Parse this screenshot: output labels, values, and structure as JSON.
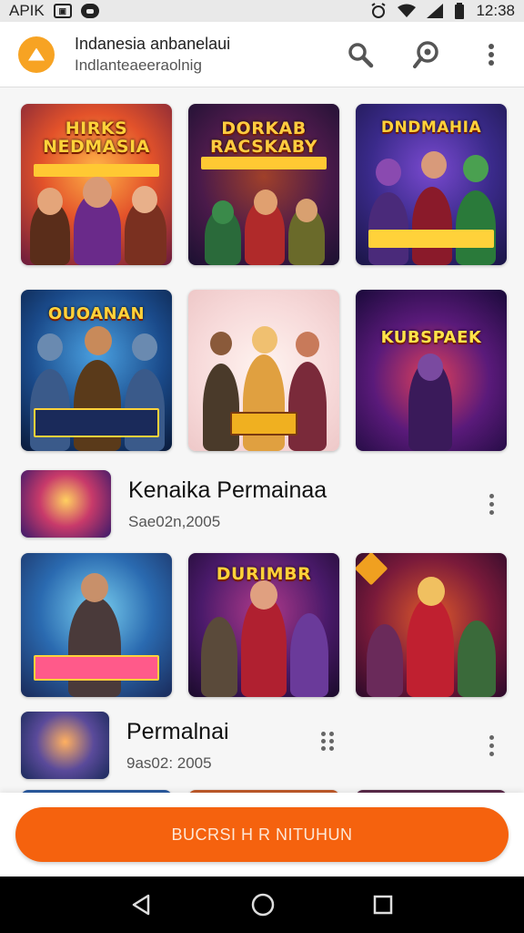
{
  "status_bar": {
    "carrier": "APIK",
    "time": "12:38"
  },
  "app_bar": {
    "title": "Indanesia anbanelaui",
    "subtitle": "Indlanteaeeraolnig"
  },
  "grid_top": [
    {
      "title": "HIRKS NEDMASIA"
    },
    {
      "title": "DORKAB RACSKABY"
    },
    {
      "title": "DNDMAHIA"
    }
  ],
  "grid_mid": [
    {
      "title": "OUOANAN"
    },
    {
      "title": ""
    },
    {
      "title": "KUBSPAEK"
    }
  ],
  "list_items": [
    {
      "title": "Kenaika Permainaa",
      "subtitle": "Sae02n,2005"
    },
    {
      "title": "Permalnai",
      "subtitle": "9as02: 2005"
    }
  ],
  "grid_bottom": [
    {
      "title": ""
    },
    {
      "title": "DURIMBR"
    },
    {
      "title": ""
    }
  ],
  "cta_label": "BUCRSI H R NITUHUN",
  "colors": {
    "accent": "#f5620e",
    "logo": "#f7a323"
  }
}
